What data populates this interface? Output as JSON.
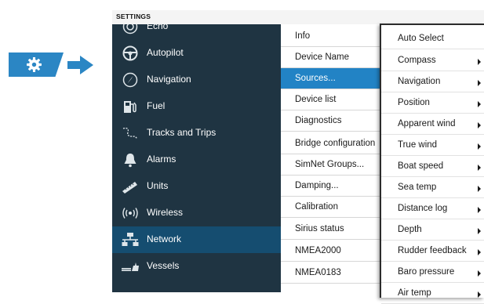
{
  "window": {
    "title": "SETTINGS"
  },
  "sidebar": {
    "items": [
      {
        "label": "Echo",
        "icon": "echo-icon"
      },
      {
        "label": "Autopilot",
        "icon": "steering-wheel-icon"
      },
      {
        "label": "Navigation",
        "icon": "compass-icon"
      },
      {
        "label": "Fuel",
        "icon": "fuel-pump-icon"
      },
      {
        "label": "Tracks and Trips",
        "icon": "track-icon"
      },
      {
        "label": "Alarms",
        "icon": "bell-icon"
      },
      {
        "label": "Units",
        "icon": "ruler-icon"
      },
      {
        "label": "Wireless",
        "icon": "wireless-icon"
      },
      {
        "label": "Network",
        "icon": "network-icon",
        "selected": true
      },
      {
        "label": "Vessels",
        "icon": "vessels-icon"
      }
    ]
  },
  "network_menu": {
    "items": [
      {
        "label": "Info"
      },
      {
        "label": "Device Name"
      },
      {
        "label": "Sources...",
        "selected": true
      },
      {
        "label": "Device list"
      },
      {
        "label": "Diagnostics"
      },
      {
        "label": "Bridge configuration"
      },
      {
        "label": "SimNet Groups..."
      },
      {
        "label": "Damping..."
      },
      {
        "label": "Calibration"
      },
      {
        "label": "Sirius status"
      },
      {
        "label": "NMEA2000"
      },
      {
        "label": "NMEA0183"
      }
    ]
  },
  "sources_popup": {
    "items": [
      {
        "label": "Auto Select",
        "submenu": false
      },
      {
        "label": "Compass",
        "submenu": true
      },
      {
        "label": "Navigation",
        "submenu": true
      },
      {
        "label": "Position",
        "submenu": true
      },
      {
        "label": "Apparent wind",
        "submenu": true
      },
      {
        "label": "True wind",
        "submenu": true
      },
      {
        "label": "Boat speed",
        "submenu": true
      },
      {
        "label": "Sea temp",
        "submenu": true
      },
      {
        "label": "Distance log",
        "submenu": true
      },
      {
        "label": "Depth",
        "submenu": true
      },
      {
        "label": "Rudder feedback",
        "submenu": true
      },
      {
        "label": "Baro pressure",
        "submenu": true
      },
      {
        "label": "Air temp",
        "submenu": true
      }
    ]
  },
  "indicator": {
    "icon": "gear-icon"
  },
  "colors": {
    "accent": "#2283c5",
    "sidebar_bg": "#1f3442",
    "sidebar_selected": "#154d70"
  }
}
